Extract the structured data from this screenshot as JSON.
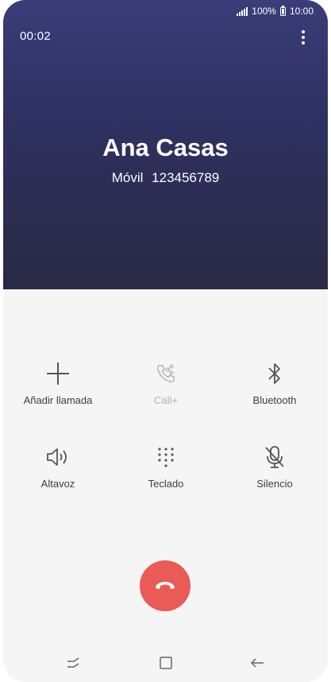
{
  "status_bar": {
    "battery": "100%",
    "time": "10:00"
  },
  "call": {
    "duration": "00:02",
    "caller_name": "Ana Casas",
    "number_type": "Móvil",
    "number": "123456789"
  },
  "actions": [
    {
      "label": "Añadir llamada",
      "icon": "add-call-icon",
      "enabled": true
    },
    {
      "label": "Call+",
      "icon": "call-plus-icon",
      "enabled": false
    },
    {
      "label": "Bluetooth",
      "icon": "bluetooth-icon",
      "enabled": true
    },
    {
      "label": "Altavoz",
      "icon": "speaker-icon",
      "enabled": true
    },
    {
      "label": "Teclado",
      "icon": "keypad-icon",
      "enabled": true
    },
    {
      "label": "Silencio",
      "icon": "mute-icon",
      "enabled": true
    }
  ],
  "colors": {
    "header_top": "#3a3d78",
    "header_bottom": "#2a2a44",
    "end_call": "#ea5a57",
    "background": "#f6f5f6"
  }
}
